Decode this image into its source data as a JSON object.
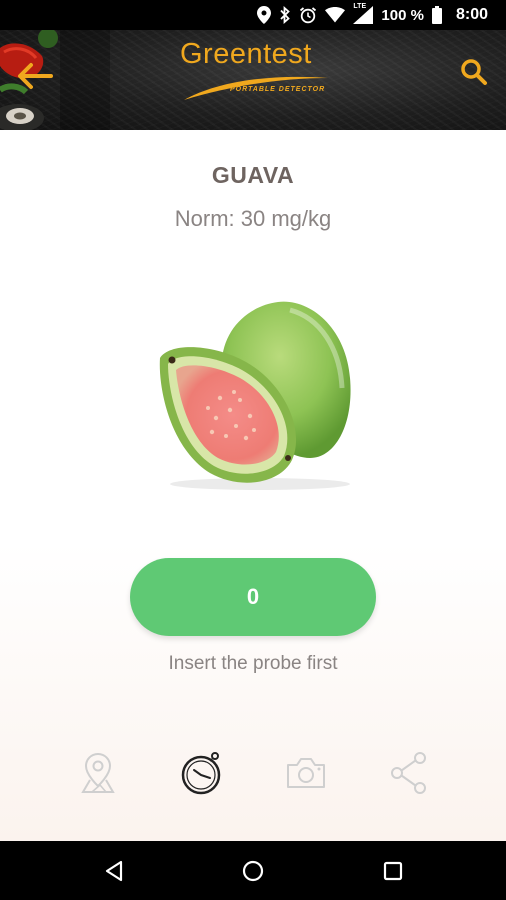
{
  "status_bar": {
    "battery_percent": "100 %",
    "time": "8:00",
    "network_label": "LTE",
    "icons": [
      "location-icon",
      "bluetooth-icon",
      "alarm-icon",
      "wifi-icon",
      "signal-icon",
      "battery-icon"
    ]
  },
  "header": {
    "logo_title": "Greentest",
    "logo_subtitle": "PORTABLE DETECTOR",
    "accent_color": "#f0a81e",
    "back_icon": "arrow-left-icon",
    "search_icon": "search-icon"
  },
  "product": {
    "name": "GUAVA",
    "norm": "Norm: 30 mg/kg",
    "image": "guava-fruit-image"
  },
  "measurement": {
    "value": "0",
    "button_color": "#5fc974",
    "hint": "Insert the probe first"
  },
  "actions": [
    {
      "name": "location",
      "icon": "map-pin-icon"
    },
    {
      "name": "timer",
      "icon": "stopwatch-icon",
      "active": true
    },
    {
      "name": "camera",
      "icon": "camera-icon"
    },
    {
      "name": "share",
      "icon": "share-icon"
    }
  ],
  "nav_bar": {
    "icons": [
      "nav-back-icon",
      "nav-home-icon",
      "nav-recents-icon"
    ]
  }
}
